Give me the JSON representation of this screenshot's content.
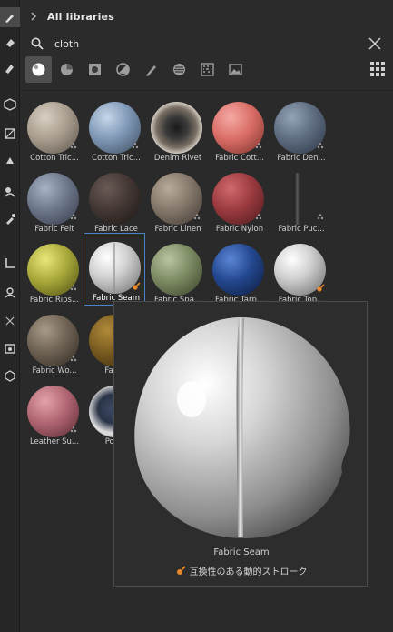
{
  "header": {
    "title": "All libraries"
  },
  "search": {
    "value": "cloth"
  },
  "filters": [
    {
      "name": "material-filter-icon",
      "active": true
    },
    {
      "name": "smart-material-filter-icon",
      "active": false
    },
    {
      "name": "smart-mask-filter-icon",
      "active": false
    },
    {
      "name": "generator-filter-icon",
      "active": false
    },
    {
      "name": "brush-filter-icon",
      "active": false
    },
    {
      "name": "alpha-filter-icon",
      "active": false
    },
    {
      "name": "grunge-filter-icon",
      "active": false
    },
    {
      "name": "environment-filter-icon",
      "active": false
    }
  ],
  "materials": [
    {
      "label": "Cotton Tric..."
    },
    {
      "label": "Cotton Tric..."
    },
    {
      "label": "Denim Rivet"
    },
    {
      "label": "Fabric Cott..."
    },
    {
      "label": "Fabric Den..."
    },
    {
      "label": "Fabric Felt"
    },
    {
      "label": "Fabric Lace"
    },
    {
      "label": "Fabric Linen"
    },
    {
      "label": "Fabric Nylon"
    },
    {
      "label": "Fabric Puc..."
    },
    {
      "label": "Fabric Rips..."
    },
    {
      "label": "Fabric Seam"
    },
    {
      "label": "Fabric Spa..."
    },
    {
      "label": "Fabric Tarp..."
    },
    {
      "label": "Fabric Top..."
    },
    {
      "label": "Fabric Wo..."
    },
    {
      "label": "Fabric"
    },
    {
      "label": "Leather Su..."
    },
    {
      "label": "Pocke"
    }
  ],
  "preview": {
    "name": "Fabric Seam",
    "description": "互換性のある動的ストローク"
  },
  "colors": {
    "accent": "#4b83c7",
    "dynamic_badge": "#e8892b"
  }
}
